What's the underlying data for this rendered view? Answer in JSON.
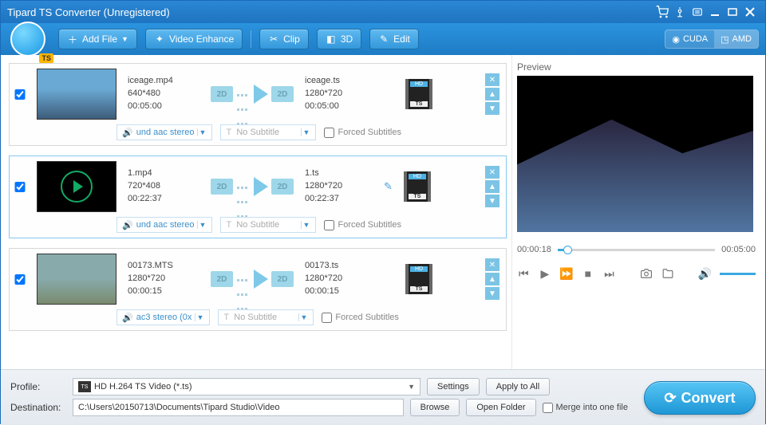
{
  "window": {
    "title": "Tipard TS Converter (Unregistered)"
  },
  "toolbar": {
    "add_file": "Add File",
    "video_enhance": "Video Enhance",
    "clip": "Clip",
    "three_d": "3D",
    "edit": "Edit",
    "gpu_cuda": "CUDA",
    "gpu_amd": "AMD"
  },
  "files": [
    {
      "src_name": "iceage.mp4",
      "src_res": "640*480",
      "src_dur": "00:05:00",
      "out_name": "iceage.ts",
      "out_res": "1280*720",
      "out_dur": "00:05:00",
      "audio": "und aac stereo",
      "subtitle_placeholder": "No Subtitle",
      "forced_label": "Forced Subtitles",
      "thumb": "ice"
    },
    {
      "src_name": "1.mp4",
      "src_res": "720*408",
      "src_dur": "00:22:37",
      "out_name": "1.ts",
      "out_res": "1280*720",
      "out_dur": "00:22:37",
      "audio": "und aac stereo",
      "subtitle_placeholder": "No Subtitle",
      "forced_label": "Forced Subtitles",
      "thumb": "play"
    },
    {
      "src_name": "00173.MTS",
      "src_res": "1280*720",
      "src_dur": "00:00:15",
      "out_name": "00173.ts",
      "out_res": "1280*720",
      "out_dur": "00:00:15",
      "audio": "ac3 stereo (0x",
      "subtitle_placeholder": "No Subtitle",
      "forced_label": "Forced Subtitles",
      "thumb": "boy"
    }
  ],
  "preview": {
    "label": "Preview",
    "cur_time": "00:00:18",
    "total_time": "00:05:00",
    "progress_pct": 6
  },
  "footer": {
    "profile_label": "Profile:",
    "profile_value": "HD H.264 TS Video (*.ts)",
    "settings": "Settings",
    "apply_all": "Apply to All",
    "dest_label": "Destination:",
    "dest_value": "C:\\Users\\20150713\\Documents\\Tipard Studio\\Video",
    "browse": "Browse",
    "open_folder": "Open Folder",
    "merge": "Merge into one file",
    "convert": "Convert"
  },
  "badges": {
    "two_d": "2D",
    "hd": "HD",
    "ts": "TS"
  }
}
